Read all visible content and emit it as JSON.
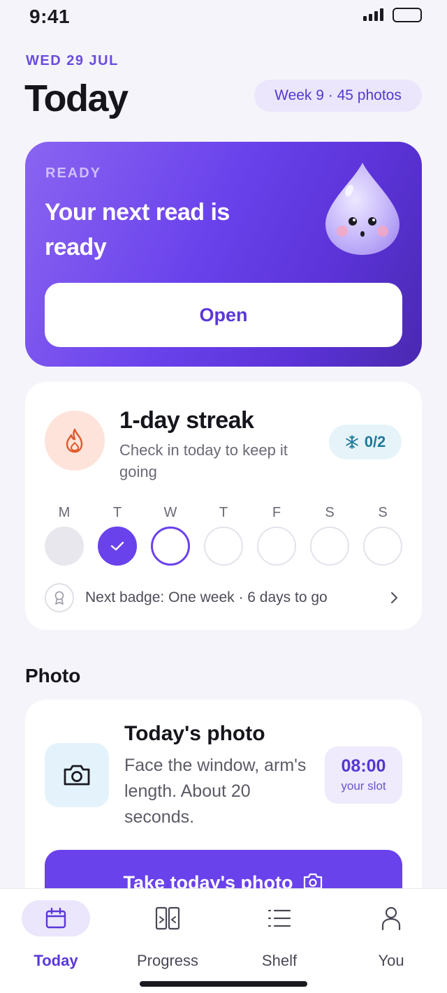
{
  "status_bar": {
    "time": "9:41"
  },
  "header": {
    "date": "WED 29 JUL",
    "title": "Today",
    "week_pill": "Week 9 · 45 photos"
  },
  "ready_card": {
    "eyebrow": "READY",
    "headline": "Your next read is ready",
    "button_label": "Open"
  },
  "streak": {
    "title": "1-day streak",
    "subtitle": "Check in today to keep it going",
    "freeze_count": "0/2",
    "days": [
      {
        "letter": "M",
        "state": "past"
      },
      {
        "letter": "T",
        "state": "done"
      },
      {
        "letter": "W",
        "state": "today"
      },
      {
        "letter": "T",
        "state": "upcoming"
      },
      {
        "letter": "F",
        "state": "upcoming"
      },
      {
        "letter": "S",
        "state": "upcoming"
      },
      {
        "letter": "S",
        "state": "upcoming"
      }
    ],
    "next_badge": "Next badge: One week · 6 days to go"
  },
  "photo_section": {
    "heading": "Photo",
    "title": "Today's photo",
    "description": "Face the window, arm's length. About 20 seconds.",
    "slot_time": "08:00",
    "slot_label": "your slot",
    "button_label": "Take today's photo"
  },
  "tab_bar": {
    "tabs": [
      {
        "label": "Today",
        "icon": "calendar-icon",
        "active": true
      },
      {
        "label": "Progress",
        "icon": "compare-icon",
        "active": false
      },
      {
        "label": "Shelf",
        "icon": "list-icon",
        "active": false
      },
      {
        "label": "You",
        "icon": "person-icon",
        "active": false
      }
    ]
  },
  "colors": {
    "accent": "#6a42ec",
    "background": "#f5f4fb",
    "streak_fire": "#e0592a",
    "freeze": "#1f7a9c"
  }
}
